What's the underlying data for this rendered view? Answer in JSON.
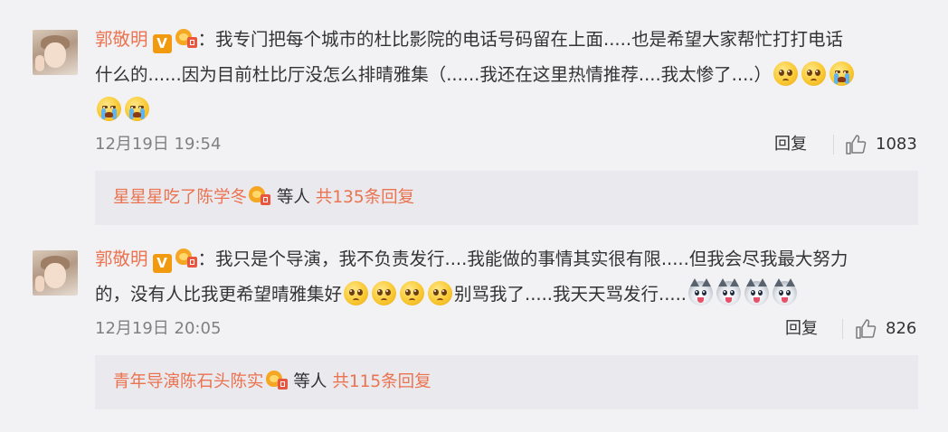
{
  "comments": [
    {
      "username": "郭敬明",
      "vbadge": "V",
      "separator": "：",
      "text_line1": "我专门把每个城市的杜比影院的电话号码留在上面.....也是希望大家帮忙打打电话",
      "text_line2": "什么的......因为目前杜比厅没怎么排晴雅集（......我还在这里热情推荐....我太惨了....）",
      "emojis_line2": [
        "sad-face",
        "sad-face",
        "crying-face"
      ],
      "emojis_line3": [
        "crying-face",
        "crying-face"
      ],
      "date": "12月19日 19:54",
      "reply_label": "回复",
      "like_count": "1083",
      "replies": {
        "name": "星星星吃了陈学冬",
        "suffix": "等人",
        "count_text": "共135条回复"
      }
    },
    {
      "username": "郭敬明",
      "vbadge": "V",
      "separator": "：",
      "text_line1": "我只是个导演，我不负责发行....我能做的事情其实很有限.....但我会尽我最大努力",
      "text_line2_a": "的，没有人比我更希望晴雅集好",
      "text_line2_b": "别骂我了.....我天天骂发行.....",
      "emojis_mid": [
        "sad-face",
        "sad-face",
        "sad-face",
        "sad-face"
      ],
      "emojis_end": [
        "husky-face",
        "husky-face",
        "husky-face",
        "husky-face"
      ],
      "date": "12月19日 20:05",
      "reply_label": "回复",
      "like_count": "826",
      "replies": {
        "name": "青年导演陈石头陈实",
        "suffix": "等人",
        "count_text": "共115条回复"
      }
    }
  ],
  "colors": {
    "background": "#f2f2f5",
    "username": "#eb7350",
    "reply_panel": "#e9e9ee",
    "meta_text": "#808080"
  }
}
